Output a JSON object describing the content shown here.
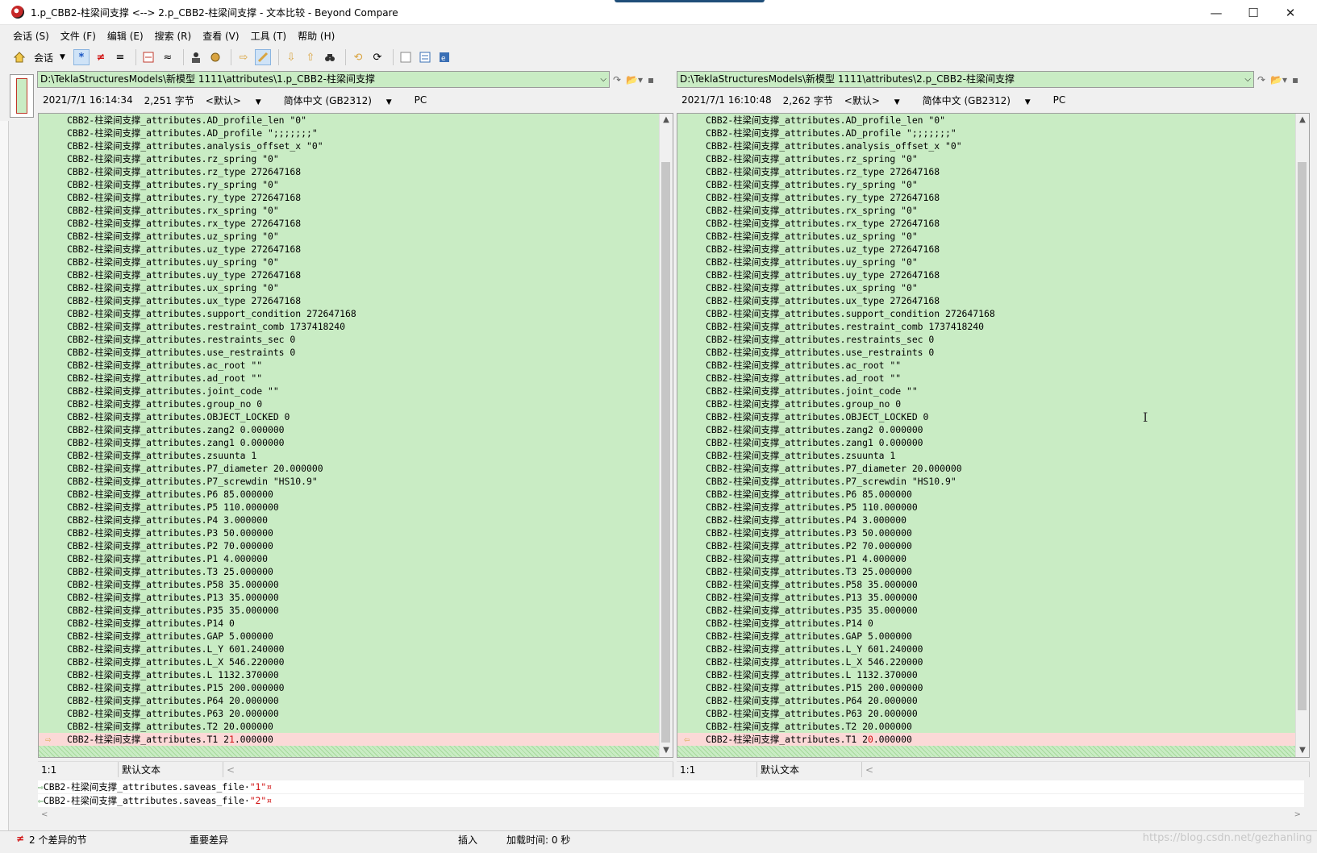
{
  "window": {
    "title": "1.p_CBB2-柱梁间支撑 <--> 2.p_CBB2-柱梁间支撑 - 文本比较 - Beyond Compare",
    "minimize": "—",
    "maximize": "☐",
    "close": "✕"
  },
  "menu": [
    "会话 (S)",
    "文件 (F)",
    "编辑 (E)",
    "搜索 (R)",
    "查看 (V)",
    "工具 (T)",
    "帮助 (H)"
  ],
  "toolbar": {
    "session_label": "会话"
  },
  "left": {
    "path": "D:\\TeklaStructuresModels\\新模型 1111\\attributes\\1.p_CBB2-柱梁间支撑",
    "datetime": "2021/7/1 16:14:34",
    "size": "2,251 字节",
    "format": "<默认>",
    "encoding": "简体中文 (GB2312)",
    "lineend": "PC",
    "last_line_prefix": "CBB2-柱梁间支撑_attributes.T1 2",
    "last_line_diff": "1",
    "last_line_suffix": ".000000",
    "status_pos": "1:1",
    "status_mode": "默认文本"
  },
  "right": {
    "path": "D:\\TeklaStructuresModels\\新模型 1111\\attributes\\2.p_CBB2-柱梁间支撑",
    "datetime": "2021/7/1 16:10:48",
    "size": "2,262 字节",
    "format": "<默认>",
    "encoding": "简体中文 (GB2312)",
    "lineend": "PC",
    "last_line_prefix": "CBB2-柱梁间支撑_attributes.T1 2",
    "last_line_diff": "0",
    "last_line_suffix": ".000000",
    "status_pos": "1:1",
    "status_mode": "默认文本"
  },
  "lines": [
    "CBB2-柱梁间支撑_attributes.AD_profile_len \"0\"",
    "CBB2-柱梁间支撑_attributes.AD_profile \";;;;;;;\"",
    "CBB2-柱梁间支撑_attributes.analysis_offset_x \"0\"",
    "CBB2-柱梁间支撑_attributes.rz_spring \"0\"",
    "CBB2-柱梁间支撑_attributes.rz_type 272647168",
    "CBB2-柱梁间支撑_attributes.ry_spring \"0\"",
    "CBB2-柱梁间支撑_attributes.ry_type 272647168",
    "CBB2-柱梁间支撑_attributes.rx_spring \"0\"",
    "CBB2-柱梁间支撑_attributes.rx_type 272647168",
    "CBB2-柱梁间支撑_attributes.uz_spring \"0\"",
    "CBB2-柱梁间支撑_attributes.uz_type 272647168",
    "CBB2-柱梁间支撑_attributes.uy_spring \"0\"",
    "CBB2-柱梁间支撑_attributes.uy_type 272647168",
    "CBB2-柱梁间支撑_attributes.ux_spring \"0\"",
    "CBB2-柱梁间支撑_attributes.ux_type 272647168",
    "CBB2-柱梁间支撑_attributes.support_condition 272647168",
    "CBB2-柱梁间支撑_attributes.restraint_comb 1737418240",
    "CBB2-柱梁间支撑_attributes.restraints_sec 0",
    "CBB2-柱梁间支撑_attributes.use_restraints 0",
    "CBB2-柱梁间支撑_attributes.ac_root \"\"",
    "CBB2-柱梁间支撑_attributes.ad_root \"\"",
    "CBB2-柱梁间支撑_attributes.joint_code \"\"",
    "CBB2-柱梁间支撑_attributes.group_no 0",
    "CBB2-柱梁间支撑_attributes.OBJECT_LOCKED 0",
    "CBB2-柱梁间支撑_attributes.zang2 0.000000",
    "CBB2-柱梁间支撑_attributes.zang1 0.000000",
    "CBB2-柱梁间支撑_attributes.zsuunta 1",
    "CBB2-柱梁间支撑_attributes.P7_diameter 20.000000",
    "CBB2-柱梁间支撑_attributes.P7_screwdin \"HS10.9\"",
    "CBB2-柱梁间支撑_attributes.P6 85.000000",
    "CBB2-柱梁间支撑_attributes.P5 110.000000",
    "CBB2-柱梁间支撑_attributes.P4 3.000000",
    "CBB2-柱梁间支撑_attributes.P3 50.000000",
    "CBB2-柱梁间支撑_attributes.P2 70.000000",
    "CBB2-柱梁间支撑_attributes.P1 4.000000",
    "CBB2-柱梁间支撑_attributes.T3 25.000000",
    "CBB2-柱梁间支撑_attributes.P58 35.000000",
    "CBB2-柱梁间支撑_attributes.P13 35.000000",
    "CBB2-柱梁间支撑_attributes.P35 35.000000",
    "CBB2-柱梁间支撑_attributes.P14 0",
    "CBB2-柱梁间支撑_attributes.GAP 5.000000",
    "CBB2-柱梁间支撑_attributes.L_Y 601.240000",
    "CBB2-柱梁间支撑_attributes.L_X 546.220000",
    "CBB2-柱梁间支撑_attributes.L 1132.370000",
    "CBB2-柱梁间支撑_attributes.P15 200.000000",
    "CBB2-柱梁间支撑_attributes.P64 20.000000",
    "CBB2-柱梁间支撑_attributes.P63 20.000000",
    "CBB2-柱梁间支撑_attributes.T2 20.000000"
  ],
  "detail": {
    "line1_prefix": "CBB2-柱梁间支撑_attributes.saveas_file·",
    "line1_quoted": "\"1\"",
    "line2_prefix": "CBB2-柱梁间支撑_attributes.saveas_file·",
    "line2_quoted": "\"2\"",
    "pilcrow": "¤"
  },
  "status": {
    "diff_count": "2 个差异的节",
    "importance": "重要差异",
    "mode": "插入",
    "load_time": "加载时间: 0 秒"
  },
  "watermark": "https://blog.csdn.net/gezhanling"
}
